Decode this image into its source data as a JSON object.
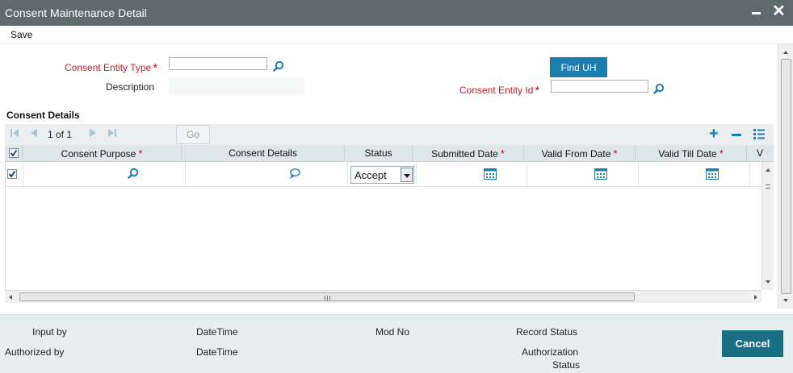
{
  "window": {
    "title": "Consent Maintenance Detail"
  },
  "menu": {
    "save_label": "Save"
  },
  "form": {
    "entity_type_label": "Consent Entity Type",
    "entity_type_value": "",
    "description_label": "Description",
    "description_value": "",
    "find_uh_label": "Find UH",
    "entity_id_label": "Consent Entity Id",
    "entity_id_value": "",
    "required_marker": "*"
  },
  "consent_details": {
    "section_title": "Consent Details",
    "pager": {
      "current_page": "1",
      "of_label": "of",
      "total_pages": "1",
      "go_label": "Go"
    },
    "columns": [
      {
        "label": "Consent Purpose",
        "required": true
      },
      {
        "label": "Consent Details",
        "required": false
      },
      {
        "label": "Status",
        "required": false
      },
      {
        "label": "Submitted Date",
        "required": true
      },
      {
        "label": "Valid From Date",
        "required": true
      },
      {
        "label": "Valid Till Date",
        "required": true
      },
      {
        "label": "V",
        "required": false
      }
    ],
    "rows": [
      {
        "selected": true,
        "consent_purpose": "",
        "consent_details": "",
        "status": "Accept",
        "submitted_date": "",
        "valid_from_date": "",
        "valid_till_date": ""
      }
    ],
    "header_checkbox_checked": true
  },
  "footer": {
    "input_by_label": "Input by",
    "datetime_label_1": "DateTime",
    "mod_no_label": "Mod No",
    "record_status_label": "Record Status",
    "authorized_by_label": "Authorized by",
    "datetime_label_2": "DateTime",
    "authorization_status_line1": "Authorization",
    "authorization_status_line2": "Status",
    "cancel_label": "Cancel"
  },
  "colors": {
    "titlebar": "#5f6a6d",
    "accent_button": "#1a7fae",
    "cancel_button": "#1a6f85",
    "required_label": "#c2202e",
    "footer_bg": "#e6eef0"
  },
  "icons": {
    "lookup": "magnifier-icon",
    "comment": "speech-bubble-icon",
    "calendar": "calendar-icon",
    "add": "plus-icon",
    "remove": "minus-icon",
    "list": "list-view-icon"
  }
}
